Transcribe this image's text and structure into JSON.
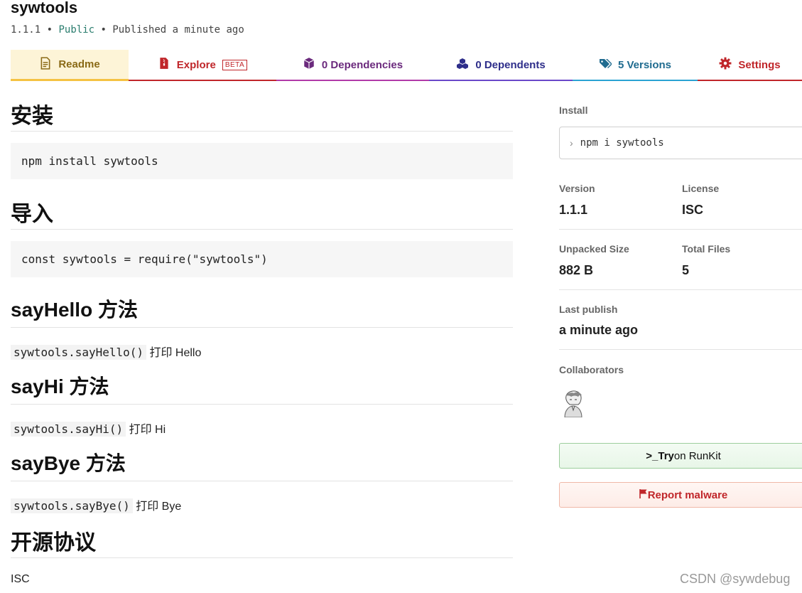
{
  "package": {
    "name": "sywtools",
    "version": "1.1.1",
    "visibility": "Public",
    "published": "Published a minute ago",
    "separator": "•"
  },
  "tabs": [
    {
      "label": "Readme",
      "icon": "file-text-icon"
    },
    {
      "label": "Explore",
      "badge": "BETA",
      "icon": "zip-file-icon"
    },
    {
      "label": "0 Dependencies",
      "icon": "box-icon"
    },
    {
      "label": "0 Dependents",
      "icon": "boxes-icon"
    },
    {
      "label": "5 Versions",
      "icon": "tags-icon"
    },
    {
      "label": "Settings",
      "icon": "gear-icon"
    }
  ],
  "readme": {
    "sections": [
      {
        "heading": "安装",
        "code": "npm install sywtools"
      },
      {
        "heading": "导入",
        "code": "const sywtools = require(\"sywtools\")"
      },
      {
        "heading": "sayHello 方法",
        "inline_code": "sywtools.sayHello()",
        "text": " 打印 Hello"
      },
      {
        "heading": "sayHi 方法",
        "inline_code": "sywtools.sayHi()",
        "text": " 打印 Hi"
      },
      {
        "heading": "sayBye 方法",
        "inline_code": "sywtools.sayBye()",
        "text": " 打印 Bye"
      },
      {
        "heading": "开源协议",
        "text": "ISC"
      }
    ]
  },
  "sidebar": {
    "install_label": "Install",
    "install_command": "npm i sywtools",
    "version_label": "Version",
    "version_value": "1.1.1",
    "license_label": "License",
    "license_value": "ISC",
    "unpacked_size_label": "Unpacked Size",
    "unpacked_size_value": "882 B",
    "total_files_label": "Total Files",
    "total_files_value": "5",
    "last_publish_label": "Last publish",
    "last_publish_value": "a minute ago",
    "collaborators_label": "Collaborators",
    "runkit_prefix": ">_",
    "runkit_bold": "Try",
    "runkit_rest": " on RunKit",
    "report_label": "Report malware"
  },
  "watermark": "CSDN @sywdebug",
  "colors": {
    "readme_tab_bg": "#fdf4d7",
    "readme_tab_border": "#f5c242",
    "npm_red": "#c0262a",
    "public_green": "#2a7d6e"
  }
}
